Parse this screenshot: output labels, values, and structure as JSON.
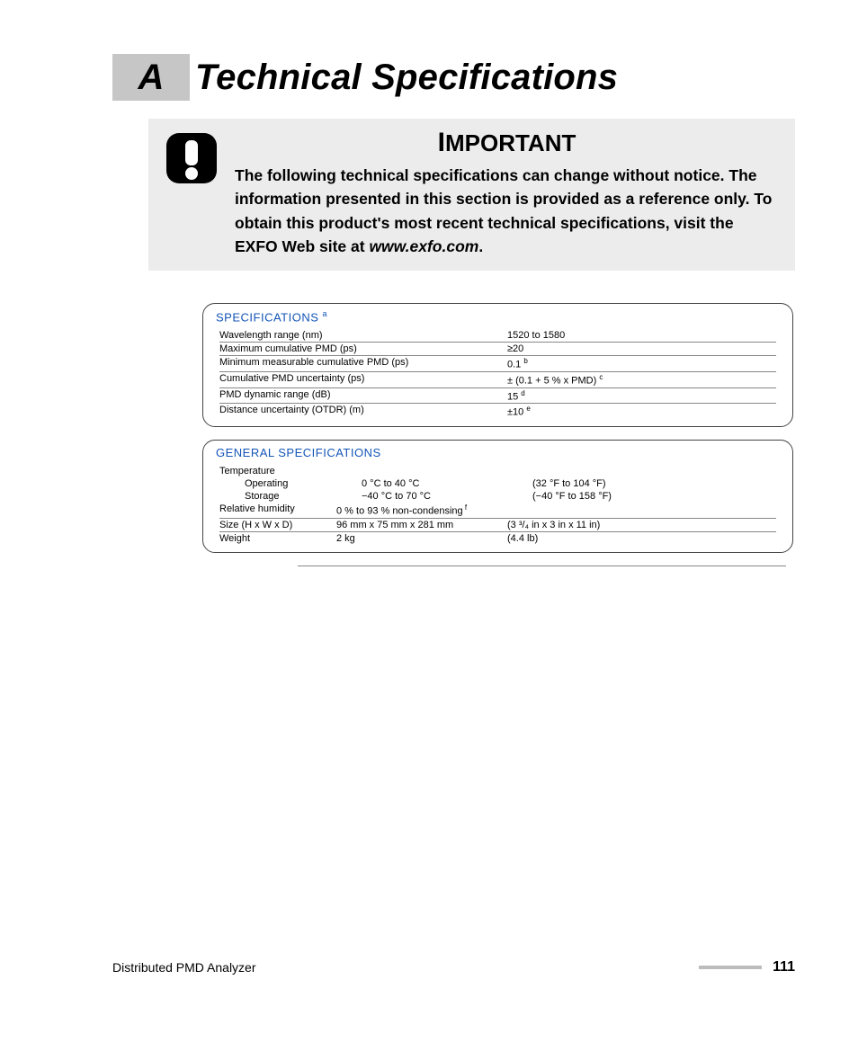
{
  "appendix": "A",
  "title": "Technical Specifications",
  "important": {
    "heading": "Important",
    "text_parts": [
      "The following technical specifications can change without notice. The information presented in this section is provided as a reference only. To obtain this product's most recent technical specifications, visit the EXFO Web site at ",
      "www.exfo.com",
      "."
    ]
  },
  "specs1": {
    "title": "SPECIFICATIONS",
    "title_sup": "a",
    "rows": [
      {
        "label": "Wavelength range (nm)",
        "value": "1520 to 1580",
        "sup": ""
      },
      {
        "label": "Maximum cumulative PMD (ps)",
        "value": "≥20",
        "sup": ""
      },
      {
        "label": "Minimum measurable cumulative PMD (ps)",
        "value": "0.1",
        "sup": "b"
      },
      {
        "label": "Cumulative PMD uncertainty (ps)",
        "value": "± (0.1 + 5 % x PMD)",
        "sup": "c"
      },
      {
        "label": "PMD dynamic range (dB)",
        "value": "15",
        "sup": "d"
      },
      {
        "label": "Distance uncertainty (OTDR) (m)",
        "value": "±10",
        "sup": "e"
      }
    ]
  },
  "specs2": {
    "title": "GENERAL SPECIFICATIONS",
    "temp_label": "Temperature",
    "rows_temp": [
      {
        "sub": "Operating",
        "v1": "0 °C to 40 °C",
        "v2": "(32 °F to 104 °F)"
      },
      {
        "sub": "Storage",
        "v1": "−40 °C to 70 °C",
        "v2": "(−40 °F to 158 °F)"
      }
    ],
    "rows": [
      {
        "label": "Relative humidity",
        "v1": "0 % to 93 % non-condensing",
        "sup": "f",
        "v2": ""
      },
      {
        "label": "Size (H x W x D)",
        "v1": "96 mm x 75 mm x 281 mm",
        "sup": "",
        "v2": "(3 ³/₄ in x 3 in x 11 in)"
      },
      {
        "label": "Weight",
        "v1": "2 kg",
        "sup": "",
        "v2": "(4.4 lb)"
      }
    ]
  },
  "footer": {
    "doc": "Distributed PMD Analyzer",
    "page": "111"
  }
}
